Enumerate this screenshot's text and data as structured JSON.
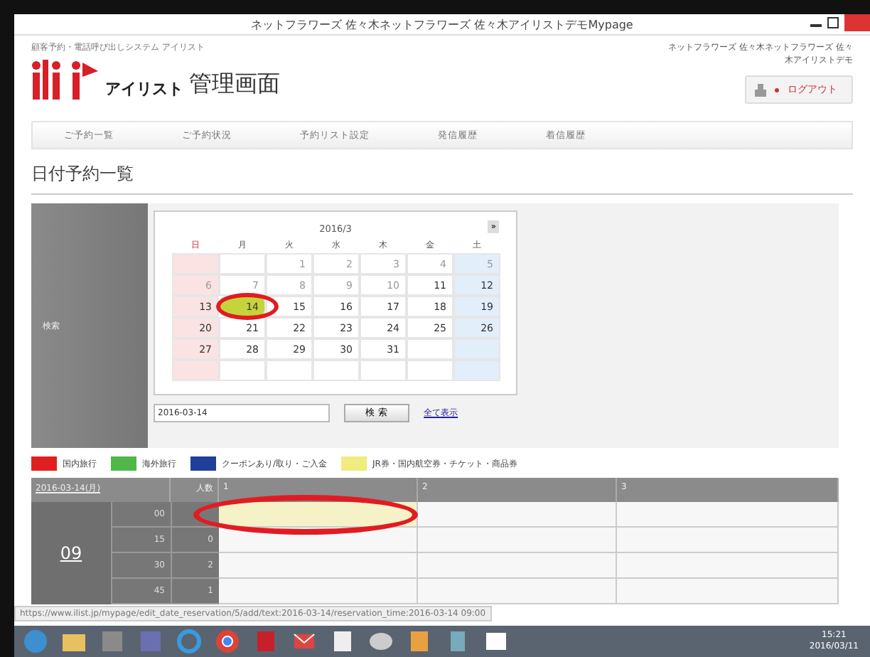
{
  "window": {
    "title": "ネットフラワーズ 佐々木ネットフラワーズ 佐々木アイリストデモMypage"
  },
  "header": {
    "system_name": "顧客予約・電話呼び出しシステム アイリスト",
    "logo_text": "アイリスト",
    "page_title": "管理画面",
    "user": "ネットフラワーズ 佐々木ネットフラワーズ 佐々木アイリストデモ",
    "logout": "ログアウト"
  },
  "nav": [
    {
      "label": "ご予約一覧"
    },
    {
      "label": "ご予約状況"
    },
    {
      "label": "予約リスト設定"
    },
    {
      "label": "発信履歴"
    },
    {
      "label": "着信履歴"
    }
  ],
  "heading": "日付予約一覧",
  "search": {
    "label": "検索",
    "calendar": {
      "month": "2016/3",
      "next": "»",
      "weekdays": [
        "日",
        "月",
        "火",
        "水",
        "木",
        "金",
        "土"
      ],
      "weeks": [
        [
          {
            "kind": "blank"
          },
          {
            "kind": "blank"
          },
          {
            "kind": "day",
            "day": "1",
            "muted": true,
            "selected": false
          },
          {
            "kind": "day",
            "day": "2",
            "muted": true,
            "selected": false
          },
          {
            "kind": "day",
            "day": "3",
            "muted": true,
            "selected": false
          },
          {
            "kind": "day",
            "day": "4",
            "muted": true,
            "selected": false
          },
          {
            "kind": "day",
            "day": "5",
            "muted": true,
            "selected": false
          }
        ],
        [
          {
            "kind": "day",
            "day": "6",
            "muted": true,
            "selected": false
          },
          {
            "kind": "day",
            "day": "7",
            "muted": true,
            "selected": false
          },
          {
            "kind": "day",
            "day": "8",
            "muted": true,
            "selected": false
          },
          {
            "kind": "day",
            "day": "9",
            "muted": true,
            "selected": false
          },
          {
            "kind": "day",
            "day": "10",
            "muted": true,
            "selected": false
          },
          {
            "kind": "day",
            "day": "11",
            "muted": false,
            "selected": false
          },
          {
            "kind": "day",
            "day": "12",
            "muted": false,
            "selected": false
          }
        ],
        [
          {
            "kind": "day",
            "day": "13",
            "muted": false,
            "selected": false
          },
          {
            "kind": "day",
            "day": "14",
            "muted": false,
            "selected": true,
            "circled": true
          },
          {
            "kind": "day",
            "day": "15",
            "muted": false,
            "selected": false
          },
          {
            "kind": "day",
            "day": "16",
            "muted": false,
            "selected": false
          },
          {
            "kind": "day",
            "day": "17",
            "muted": false,
            "selected": false
          },
          {
            "kind": "day",
            "day": "18",
            "muted": false,
            "selected": false
          },
          {
            "kind": "day",
            "day": "19",
            "muted": false,
            "selected": false
          }
        ],
        [
          {
            "kind": "day",
            "day": "20",
            "muted": false,
            "selected": false
          },
          {
            "kind": "day",
            "day": "21",
            "muted": false,
            "selected": false
          },
          {
            "kind": "day",
            "day": "22",
            "muted": false,
            "selected": false
          },
          {
            "kind": "day",
            "day": "23",
            "muted": false,
            "selected": false
          },
          {
            "kind": "day",
            "day": "24",
            "muted": false,
            "selected": false
          },
          {
            "kind": "day",
            "day": "25",
            "muted": false,
            "selected": false
          },
          {
            "kind": "day",
            "day": "26",
            "muted": false,
            "selected": false
          }
        ],
        [
          {
            "kind": "day",
            "day": "27",
            "muted": false,
            "selected": false
          },
          {
            "kind": "day",
            "day": "28",
            "muted": false,
            "selected": false
          },
          {
            "kind": "day",
            "day": "29",
            "muted": false,
            "selected": false
          },
          {
            "kind": "day",
            "day": "30",
            "muted": false,
            "selected": false
          },
          {
            "kind": "day",
            "day": "31",
            "muted": false,
            "selected": false
          },
          {
            "kind": "blank"
          },
          {
            "kind": "blank"
          }
        ],
        [
          {
            "kind": "blank"
          },
          {
            "kind": "blank"
          },
          {
            "kind": "blank"
          },
          {
            "kind": "blank"
          },
          {
            "kind": "blank"
          },
          {
            "kind": "blank"
          },
          {
            "kind": "blank"
          }
        ]
      ]
    },
    "date_value": "2016-03-14",
    "button": "検 索",
    "show_all": "全て表示"
  },
  "legend": [
    {
      "label": "国内旅行",
      "color": "#e02020"
    },
    {
      "label": "海外旅行",
      "color": "#50b848"
    },
    {
      "label": "クーポンあり/取り・ご入金",
      "color": "#1f3f9a"
    },
    {
      "label": "JR券・国内航空券・チケット・商品券",
      "color": "#f0ec80"
    }
  ],
  "table": {
    "date": "2016-03-14(月)",
    "count_header": "人数",
    "columns": [
      "1",
      "2",
      "3"
    ],
    "hour": "09",
    "rows": [
      {
        "minute": "00",
        "slots": [
          {
            "kind": "filled",
            "color": "#f5f2c8",
            "circled": true
          },
          {
            "kind": "empty"
          },
          {
            "kind": "empty"
          }
        ]
      },
      {
        "minute": "15",
        "count": "0",
        "slots": [
          {
            "kind": "empty"
          },
          {
            "kind": "empty"
          },
          {
            "kind": "empty"
          }
        ]
      },
      {
        "minute": "30",
        "count": "2",
        "slots": [
          {
            "kind": "empty"
          },
          {
            "kind": "empty"
          },
          {
            "kind": "empty"
          }
        ]
      },
      {
        "minute": "45",
        "count": "1",
        "slots": [
          {
            "kind": "empty"
          },
          {
            "kind": "empty"
          },
          {
            "kind": "empty"
          }
        ]
      }
    ]
  },
  "status_url": "https://www.ilist.jp/mypage/edit_date_reservation/5/add/text:2016-03-14/reservation_time:2016-03-14 09:00",
  "taskbar": {
    "time": "15:21",
    "date": "2016/03/11"
  }
}
